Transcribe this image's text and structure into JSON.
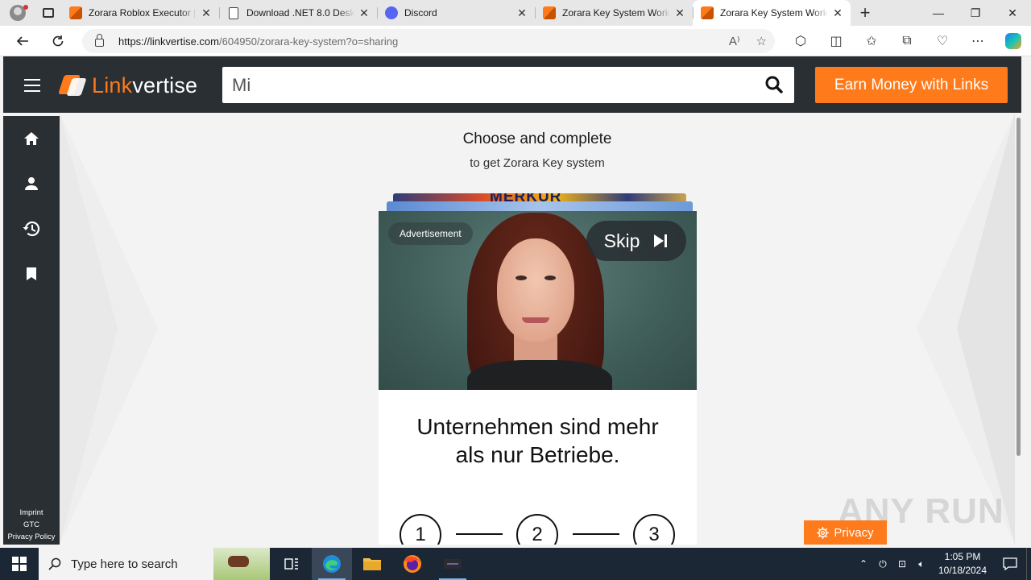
{
  "browser": {
    "tabs": [
      {
        "title": "Zorara Roblox Executor |",
        "favicon": "linkvertise-icon",
        "active": false
      },
      {
        "title": "Download .NET 8.0 Deskt",
        "favicon": "document-icon",
        "active": false
      },
      {
        "title": "Discord",
        "favicon": "discord-icon",
        "active": false
      },
      {
        "title": "Zorara Key System Worki",
        "favicon": "linkvertise-icon",
        "active": false
      },
      {
        "title": "Zorara Key System Worki",
        "favicon": "linkvertise-icon",
        "active": true
      }
    ],
    "url_domain": "https://linkvertise.com",
    "url_path": "/604950/zorara-key-system?o=sharing"
  },
  "header": {
    "logo_link": "Link",
    "logo_vertise": "vertise",
    "search_value": "Mi",
    "earn_button": "Earn Money with Links"
  },
  "sidebar": {
    "items": [
      {
        "icon": "home-icon"
      },
      {
        "icon": "user-icon"
      },
      {
        "icon": "history-icon"
      },
      {
        "icon": "bookmark-icon"
      }
    ],
    "footer": [
      "Imprint",
      "GTC",
      "Privacy Policy"
    ]
  },
  "main": {
    "heading": "Choose and complete",
    "subheading": "to get Zorara Key system",
    "stack_card_text": "MERKUR",
    "ad": {
      "label": "Advertisement",
      "skip": "Skip",
      "headline_line1": "Unternehmen sind mehr",
      "headline_line2": "als nur Betriebe.",
      "steps": [
        "1",
        "2",
        "3"
      ]
    },
    "privacy_button": "Privacy",
    "watermark": "ANY RUN"
  },
  "taskbar": {
    "search_placeholder": "Type here to search",
    "time": "1:05 PM",
    "date": "10/18/2024"
  },
  "colors": {
    "brand_orange": "#ff7a1a",
    "header_dark": "#292f33",
    "taskbar": "#1c2735"
  }
}
